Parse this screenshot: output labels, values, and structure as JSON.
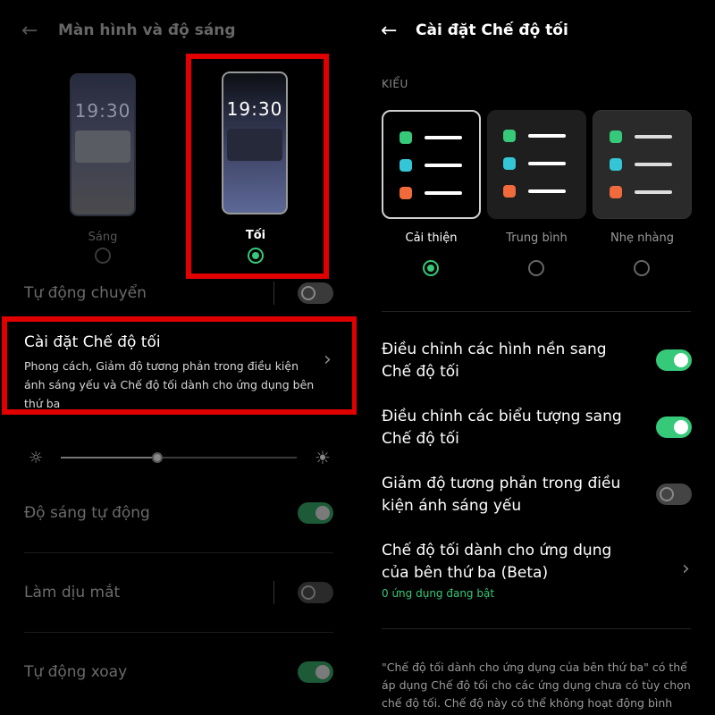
{
  "colors": {
    "accent_green": "#35c979",
    "highlight_red": "#e00000",
    "background": "#000000"
  },
  "left": {
    "back_icon": "arrow-left-icon",
    "title": "Màn hình và độ sáng",
    "theme": {
      "light": {
        "clock": "19:30",
        "label": "Sáng",
        "selected": false
      },
      "dark": {
        "clock": "19:30",
        "label": "Tối",
        "selected": true
      }
    },
    "auto_switch": {
      "label": "Tự động chuyển",
      "on": false
    },
    "dark_settings": {
      "title": "Cài đặt Chế độ tối",
      "description": "Phong cách, Giảm độ tương phản trong điều kiện ánh sáng yếu và Chế độ tối dành cho ứng dụng bên thứ ba"
    },
    "brightness": {
      "level": 0.41
    },
    "auto_brightness": {
      "label": "Độ sáng tự động",
      "on": true
    },
    "eye_comfort": {
      "label": "Làm dịu mắt",
      "on": false
    },
    "auto_rotate": {
      "label": "Tự động xoay",
      "on": true
    }
  },
  "right": {
    "back_icon": "arrow-left-icon",
    "title": "Cài đặt Chế độ tối",
    "style_heading": "KIỂU",
    "styles": [
      {
        "label": "Cải thiện",
        "selected": true
      },
      {
        "label": "Trung bình",
        "selected": false
      },
      {
        "label": "Nhẹ nhàng",
        "selected": false
      }
    ],
    "style_dot_colors": [
      "#35c979",
      "#34c6d6",
      "#f06a3c"
    ],
    "options": {
      "wallpaper": {
        "label": "Điều chỉnh các hình nền sang Chế độ tối",
        "on": true
      },
      "icons": {
        "label": "Điều chỉnh các biểu tượng sang Chế độ tối",
        "on": true
      },
      "contrast": {
        "label": "Giảm độ tương phản trong điều kiện ánh sáng yếu",
        "on": false
      }
    },
    "third_party": {
      "label": "Chế độ tối dành cho ứng dụng của bên thứ ba (Beta)",
      "status": "0 ứng dụng đang bật"
    },
    "footnote": "\"Chế độ tối dành cho ứng dụng của bên thứ ba\" có thể áp dụng Chế độ tối cho các ứng dụng chưa có tùy chọn chế độ tối. Chế độ này có thể không hoạt động bình thường"
  }
}
